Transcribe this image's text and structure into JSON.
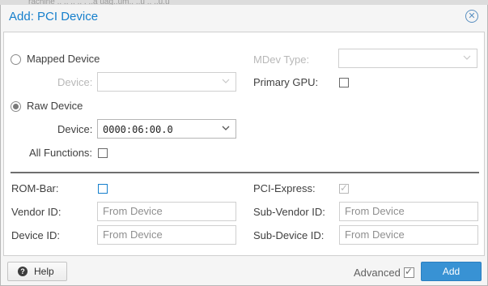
{
  "background": {
    "clipped_text": "rachine .. .. .. .. . ..a uag..um.. ..u .. ..u.u"
  },
  "dialog": {
    "title": "Add: PCI Device",
    "close_icon": "close-icon",
    "accent_color": "#157fcc"
  },
  "mapped": {
    "radio_label": "Mapped Device",
    "device_label": "Device:",
    "device_value": "",
    "mdev_label": "MDev Type:",
    "mdev_value": ""
  },
  "primary_gpu": {
    "label": "Primary GPU:",
    "checked": false
  },
  "raw": {
    "radio_label": "Raw Device",
    "selected": true,
    "device_label": "Device:",
    "device_value": "0000:06:00.0",
    "all_functions_label": "All Functions:",
    "all_functions_checked": false
  },
  "advanced_fields": {
    "rom_bar_label": "ROM-Bar:",
    "pci_express_label": "PCI-Express:",
    "vendor_id_label": "Vendor ID:",
    "vendor_id_placeholder": "From Device",
    "sub_vendor_id_label": "Sub-Vendor ID:",
    "sub_vendor_id_placeholder": "From Device",
    "device_id_label": "Device ID:",
    "device_id_placeholder": "From Device",
    "sub_device_id_label": "Sub-Device ID:",
    "sub_device_id_placeholder": "From Device"
  },
  "footer": {
    "help_label": "Help",
    "advanced_label": "Advanced",
    "advanced_checked": true,
    "add_label": "Add",
    "add_color": "#3892d4"
  }
}
